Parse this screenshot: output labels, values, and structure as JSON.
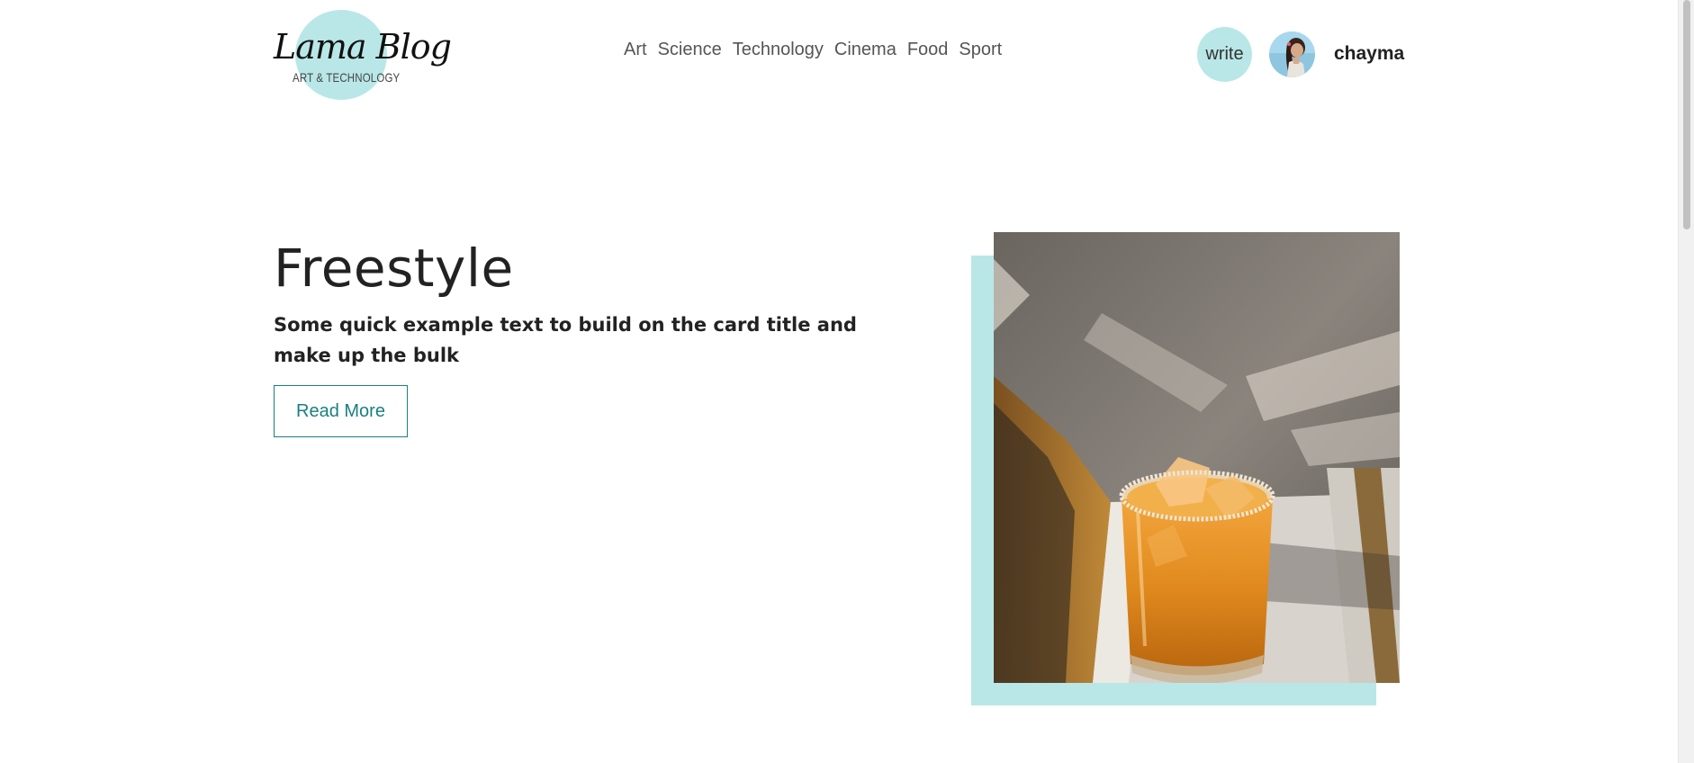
{
  "brand": {
    "title": "Lama Blog",
    "subtitle": "ART & TECHNOLOGY",
    "accent_color": "#b9e7e7"
  },
  "nav": {
    "links": [
      "Art",
      "Science",
      "Technology",
      "Cinema",
      "Food",
      "Sport"
    ],
    "write_label": "write",
    "username": "chayma",
    "avatar_icon": "user-avatar-photo"
  },
  "post": {
    "title": "Freestyle",
    "description": "Some quick example text to build on the card title and make up the bulk",
    "read_more_label": "Read More",
    "button_color": "#1a7f80",
    "image_icon": "iced-orange-drink-photo"
  }
}
